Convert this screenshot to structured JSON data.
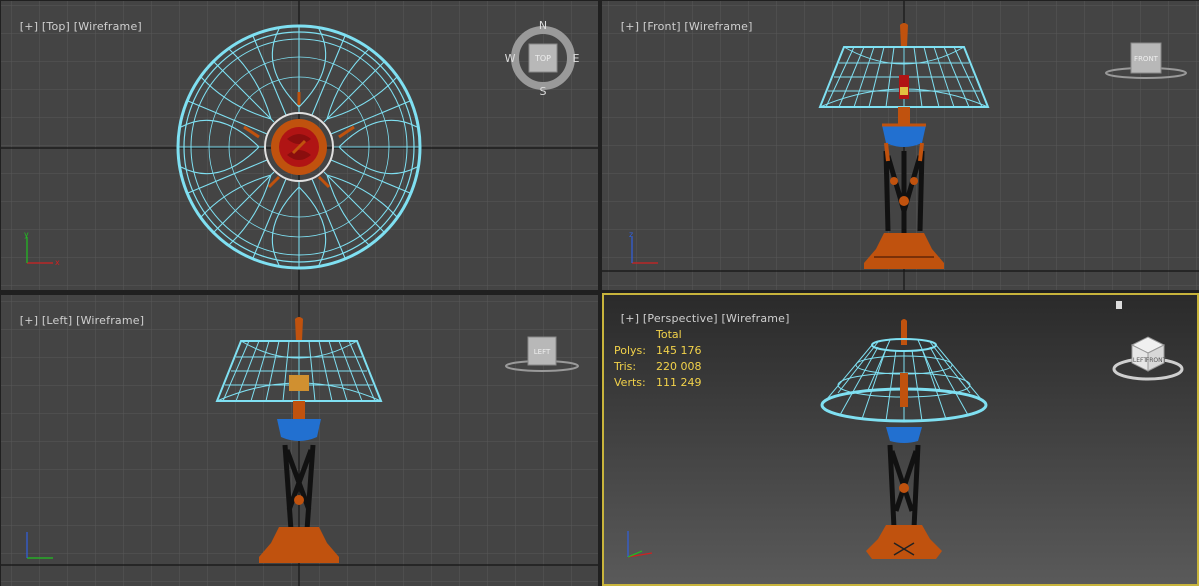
{
  "viewports": {
    "top": {
      "plus": "[+]",
      "view": "[Top]",
      "mode": "[Wireframe]"
    },
    "front": {
      "plus": "[+]",
      "view": "[Front]",
      "mode": "[Wireframe]"
    },
    "left": {
      "plus": "[+]",
      "view": "[Left]",
      "mode": "[Wireframe]"
    },
    "perspective": {
      "plus": "[+]",
      "view": "[Perspective]",
      "mode": "[Wireframe]"
    }
  },
  "stats": {
    "header": "Total",
    "polys_label": "Polys:",
    "polys": "145 176",
    "tris_label": "Tris:",
    "tris": "220 008",
    "verts_label": "Verts:",
    "verts": "111 249"
  },
  "viewcube": {
    "top_face": "TOP",
    "front_face": "FRONT",
    "left_face": "LEFT",
    "compass": {
      "n": "N",
      "s": "S",
      "e": "E",
      "w": "W"
    },
    "persp_faces": [
      "LEFT",
      "FRONT"
    ]
  },
  "axis_labels": {
    "x": "x",
    "y": "y",
    "z": "z"
  },
  "colors": {
    "background": "#444444",
    "grid": "#585858",
    "grid_axis": "#151515",
    "active_border": "#c8b43c",
    "wire": "#7fe0f2",
    "wire_dark": "#3ab0c8",
    "bronze": "#c0520e",
    "blue_glass": "#2270d0",
    "red": "#b01414",
    "stats_text": "#f2d24a"
  }
}
